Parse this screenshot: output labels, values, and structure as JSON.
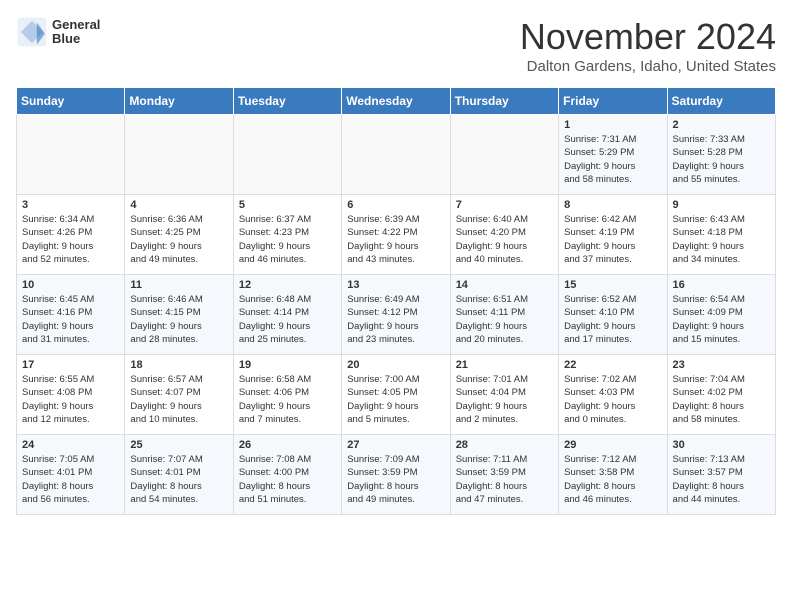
{
  "logo": {
    "line1": "General",
    "line2": "Blue"
  },
  "title": "November 2024",
  "subtitle": "Dalton Gardens, Idaho, United States",
  "headers": [
    "Sunday",
    "Monday",
    "Tuesday",
    "Wednesday",
    "Thursday",
    "Friday",
    "Saturday"
  ],
  "weeks": [
    [
      {
        "day": "",
        "info": ""
      },
      {
        "day": "",
        "info": ""
      },
      {
        "day": "",
        "info": ""
      },
      {
        "day": "",
        "info": ""
      },
      {
        "day": "",
        "info": ""
      },
      {
        "day": "1",
        "info": "Sunrise: 7:31 AM\nSunset: 5:29 PM\nDaylight: 9 hours\nand 58 minutes."
      },
      {
        "day": "2",
        "info": "Sunrise: 7:33 AM\nSunset: 5:28 PM\nDaylight: 9 hours\nand 55 minutes."
      }
    ],
    [
      {
        "day": "3",
        "info": "Sunrise: 6:34 AM\nSunset: 4:26 PM\nDaylight: 9 hours\nand 52 minutes."
      },
      {
        "day": "4",
        "info": "Sunrise: 6:36 AM\nSunset: 4:25 PM\nDaylight: 9 hours\nand 49 minutes."
      },
      {
        "day": "5",
        "info": "Sunrise: 6:37 AM\nSunset: 4:23 PM\nDaylight: 9 hours\nand 46 minutes."
      },
      {
        "day": "6",
        "info": "Sunrise: 6:39 AM\nSunset: 4:22 PM\nDaylight: 9 hours\nand 43 minutes."
      },
      {
        "day": "7",
        "info": "Sunrise: 6:40 AM\nSunset: 4:20 PM\nDaylight: 9 hours\nand 40 minutes."
      },
      {
        "day": "8",
        "info": "Sunrise: 6:42 AM\nSunset: 4:19 PM\nDaylight: 9 hours\nand 37 minutes."
      },
      {
        "day": "9",
        "info": "Sunrise: 6:43 AM\nSunset: 4:18 PM\nDaylight: 9 hours\nand 34 minutes."
      }
    ],
    [
      {
        "day": "10",
        "info": "Sunrise: 6:45 AM\nSunset: 4:16 PM\nDaylight: 9 hours\nand 31 minutes."
      },
      {
        "day": "11",
        "info": "Sunrise: 6:46 AM\nSunset: 4:15 PM\nDaylight: 9 hours\nand 28 minutes."
      },
      {
        "day": "12",
        "info": "Sunrise: 6:48 AM\nSunset: 4:14 PM\nDaylight: 9 hours\nand 25 minutes."
      },
      {
        "day": "13",
        "info": "Sunrise: 6:49 AM\nSunset: 4:12 PM\nDaylight: 9 hours\nand 23 minutes."
      },
      {
        "day": "14",
        "info": "Sunrise: 6:51 AM\nSunset: 4:11 PM\nDaylight: 9 hours\nand 20 minutes."
      },
      {
        "day": "15",
        "info": "Sunrise: 6:52 AM\nSunset: 4:10 PM\nDaylight: 9 hours\nand 17 minutes."
      },
      {
        "day": "16",
        "info": "Sunrise: 6:54 AM\nSunset: 4:09 PM\nDaylight: 9 hours\nand 15 minutes."
      }
    ],
    [
      {
        "day": "17",
        "info": "Sunrise: 6:55 AM\nSunset: 4:08 PM\nDaylight: 9 hours\nand 12 minutes."
      },
      {
        "day": "18",
        "info": "Sunrise: 6:57 AM\nSunset: 4:07 PM\nDaylight: 9 hours\nand 10 minutes."
      },
      {
        "day": "19",
        "info": "Sunrise: 6:58 AM\nSunset: 4:06 PM\nDaylight: 9 hours\nand 7 minutes."
      },
      {
        "day": "20",
        "info": "Sunrise: 7:00 AM\nSunset: 4:05 PM\nDaylight: 9 hours\nand 5 minutes."
      },
      {
        "day": "21",
        "info": "Sunrise: 7:01 AM\nSunset: 4:04 PM\nDaylight: 9 hours\nand 2 minutes."
      },
      {
        "day": "22",
        "info": "Sunrise: 7:02 AM\nSunset: 4:03 PM\nDaylight: 9 hours\nand 0 minutes."
      },
      {
        "day": "23",
        "info": "Sunrise: 7:04 AM\nSunset: 4:02 PM\nDaylight: 8 hours\nand 58 minutes."
      }
    ],
    [
      {
        "day": "24",
        "info": "Sunrise: 7:05 AM\nSunset: 4:01 PM\nDaylight: 8 hours\nand 56 minutes."
      },
      {
        "day": "25",
        "info": "Sunrise: 7:07 AM\nSunset: 4:01 PM\nDaylight: 8 hours\nand 54 minutes."
      },
      {
        "day": "26",
        "info": "Sunrise: 7:08 AM\nSunset: 4:00 PM\nDaylight: 8 hours\nand 51 minutes."
      },
      {
        "day": "27",
        "info": "Sunrise: 7:09 AM\nSunset: 3:59 PM\nDaylight: 8 hours\nand 49 minutes."
      },
      {
        "day": "28",
        "info": "Sunrise: 7:11 AM\nSunset: 3:59 PM\nDaylight: 8 hours\nand 47 minutes."
      },
      {
        "day": "29",
        "info": "Sunrise: 7:12 AM\nSunset: 3:58 PM\nDaylight: 8 hours\nand 46 minutes."
      },
      {
        "day": "30",
        "info": "Sunrise: 7:13 AM\nSunset: 3:57 PM\nDaylight: 8 hours\nand 44 minutes."
      }
    ]
  ]
}
